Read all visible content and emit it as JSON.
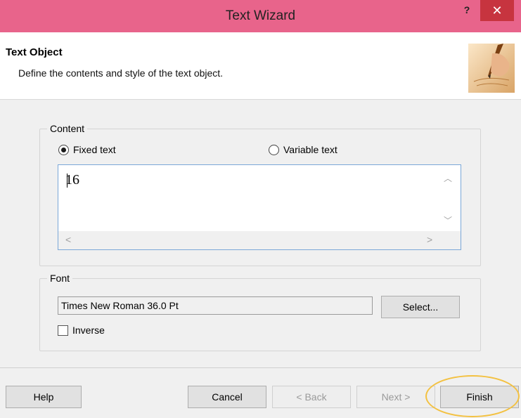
{
  "window": {
    "title": "Text Wizard",
    "help_glyph": "?",
    "close_glyph": "✕"
  },
  "header": {
    "title": "Text Object",
    "subtitle": "Define the contents and style of the text object.",
    "icon": "writing-hand-icon"
  },
  "content_group": {
    "label": "Content",
    "fixed_text_label": "Fixed text",
    "variable_text_label": "Variable text",
    "selected": "fixed",
    "text_value": "16",
    "scroll_up_glyph": "︿",
    "scroll_down_glyph": "﹀",
    "scroll_left_glyph": "<",
    "scroll_right_glyph": ">"
  },
  "font_group": {
    "label": "Font",
    "font_value": "Times New Roman 36.0 Pt",
    "select_label": "Select...",
    "inverse_label": "Inverse",
    "inverse_checked": false
  },
  "footer": {
    "help_label": "Help",
    "cancel_label": "Cancel",
    "back_label": "< Back",
    "next_label": "Next >",
    "finish_label": "Finish"
  },
  "colors": {
    "titlebar": "#e8648b",
    "close": "#c7343f",
    "highlight": "#f3c141",
    "textarea_border": "#7aa7d8"
  }
}
